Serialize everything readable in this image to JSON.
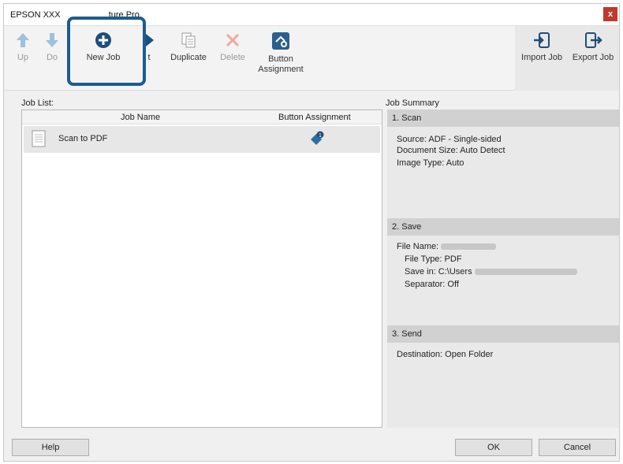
{
  "window": {
    "title": "EPSON XXX                    ture Pro",
    "close_glyph": "x"
  },
  "toolbar": {
    "up": {
      "label": "Up",
      "icon": "arrow-up-icon"
    },
    "down": {
      "label": "Do",
      "icon": "arrow-down-icon"
    },
    "new_job": {
      "label": "New Job",
      "icon": "plus-circle-icon"
    },
    "edit": {
      "label": "t",
      "icon": "edit-icon"
    },
    "duplicate": {
      "label": "Duplicate",
      "icon": "duplicate-icon"
    },
    "delete": {
      "label": "Delete",
      "icon": "delete-icon"
    },
    "button_assignment": {
      "label_line1": "Button",
      "label_line2": "Assignment",
      "icon": "button-assignment-icon"
    },
    "import_job": {
      "label": "Import Job",
      "icon": "import-icon"
    },
    "export_job": {
      "label": "Export Job",
      "icon": "export-icon"
    }
  },
  "job_list": {
    "label": "Job List:",
    "columns": [
      "Job Name",
      "Button Assignment"
    ],
    "rows": [
      {
        "name": "Scan to PDF",
        "assignment_icon": "button-assignment-icon"
      }
    ]
  },
  "job_summary": {
    "label": "Job Summary",
    "sections": {
      "scan": {
        "title": "1. Scan",
        "source": "Source: ADF - Single-sided",
        "doc_size": "Document Size: Auto Detect",
        "image_type": "Image Type: Auto"
      },
      "save": {
        "title": "2. Save",
        "file_name": "File Name:",
        "file_type": "File Type: PDF",
        "save_in": "Save in: C:\\Users",
        "separator": "Separator: Off"
      },
      "send": {
        "title": "3. Send",
        "destination": "Destination: Open Folder"
      }
    }
  },
  "footer": {
    "help": "Help",
    "ok": "OK",
    "cancel": "Cancel"
  },
  "colors": {
    "highlight": "#1d5c8c",
    "icon_blue": "#2c6fa8",
    "close_red": "#c0392b"
  }
}
